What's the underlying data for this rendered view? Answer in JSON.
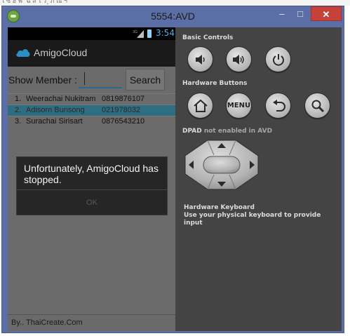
{
  "window": {
    "title": "5554:AVD",
    "minimize_label": "–",
    "maximize_label": "□",
    "close_label": "✕"
  },
  "phone": {
    "status": {
      "time": "3:54",
      "network": "3G"
    },
    "actionbar": {
      "app_name": "AmigoCloud"
    },
    "form": {
      "show_member_label": "Show Member :",
      "member_input_value": "",
      "search_label": "Search"
    },
    "members": [
      {
        "num": "1.",
        "name": "Weerachai Nukitram",
        "phone": "0819876107",
        "selected": false
      },
      {
        "num": "2.",
        "name": "Adisorn Bunsong",
        "phone": "021978032",
        "selected": true
      },
      {
        "num": "3.",
        "name": "Surachai Sirisart",
        "phone": "0876543210",
        "selected": false
      }
    ],
    "footer": "By.. ThaiCreate.Com",
    "dialog": {
      "message": "Unfortunately, AmigoCloud has stopped.",
      "ok_label": "OK"
    }
  },
  "controls": {
    "basic_controls_label": "Basic Controls",
    "hardware_buttons_label": "Hardware Buttons",
    "menu_label": "MENU",
    "dpad_label": "DPAD",
    "dpad_note": "not enabled in AVD",
    "keyboard_title": "Hardware Keyboard",
    "keyboard_desc": "Use your physical keyboard to provide input"
  },
  "colors": {
    "window_frame": "#5b6fa6",
    "close_button": "#c7413b",
    "accent_blue": "#48b6e6",
    "selected_row": "#2f6d80"
  }
}
